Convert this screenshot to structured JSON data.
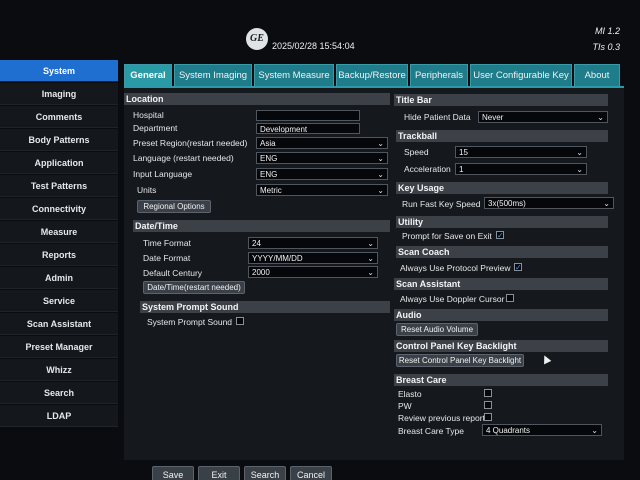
{
  "header": {
    "datetime": "2025/02/28 15:54:04",
    "mi": "MI 1.2",
    "tis": "TIs 0.3",
    "logo": "GE"
  },
  "sidebar": {
    "items": [
      {
        "label": "System",
        "active": true
      },
      {
        "label": "Imaging"
      },
      {
        "label": "Comments"
      },
      {
        "label": "Body Patterns"
      },
      {
        "label": "Application"
      },
      {
        "label": "Test Patterns"
      },
      {
        "label": "Connectivity"
      },
      {
        "label": "Measure"
      },
      {
        "label": "Reports"
      },
      {
        "label": "Admin"
      },
      {
        "label": "Service"
      },
      {
        "label": "Scan Assistant"
      },
      {
        "label": "Preset Manager"
      },
      {
        "label": "Whizz"
      },
      {
        "label": "Search"
      },
      {
        "label": "LDAP"
      }
    ]
  },
  "tabs": [
    {
      "label": "General",
      "active": true
    },
    {
      "label": "System Imaging"
    },
    {
      "label": "System Measure"
    },
    {
      "label": "Backup/Restore"
    },
    {
      "label": "Peripherals"
    },
    {
      "label": "User Configurable Key"
    },
    {
      "label": "About"
    }
  ],
  "location": {
    "title": "Location",
    "hospital_label": "Hospital",
    "hospital_value": "",
    "department_label": "Department",
    "department_value": "Development",
    "preset_region_label": "Preset Region(restart needed)",
    "preset_region_value": "Asia",
    "language_label": "Language (restart needed)",
    "language_value": "ENG",
    "input_language_label": "Input Language",
    "input_language_value": "ENG",
    "units_label": "Units",
    "units_value": "Metric",
    "regional_options_button": "Regional Options"
  },
  "datetime_section": {
    "title": "Date/Time",
    "time_format_label": "Time Format",
    "time_format_value": "24",
    "date_format_label": "Date Format",
    "date_format_value": "YYYY/MM/DD",
    "default_century_label": "Default Century",
    "default_century_value": "2000",
    "restart_button": "Date/Time(restart needed)"
  },
  "prompt_sound": {
    "title": "System Prompt Sound",
    "label": "System Prompt Sound",
    "checked": false
  },
  "title_bar": {
    "title": "Title Bar",
    "hide_label": "Hide Patient Data",
    "hide_value": "Never"
  },
  "trackball": {
    "title": "Trackball",
    "speed_label": "Speed",
    "speed_value": "15",
    "accel_label": "Acceleration",
    "accel_value": "1"
  },
  "key_usage": {
    "title": "Key Usage",
    "label": "Run Fast Key Speed",
    "value": "3x(500ms)"
  },
  "utility": {
    "title": "Utility",
    "label": "Prompt for Save on Exit",
    "checked": true
  },
  "scan_coach": {
    "title": "Scan Coach",
    "label": "Always Use Protocol Preview",
    "checked": true
  },
  "scan_assistant": {
    "title": "Scan Assistant",
    "label": "Always Use Doppler Cursor",
    "checked": false
  },
  "audio": {
    "title": "Audio",
    "button": "Reset Audio Volume"
  },
  "backlight": {
    "title": "Control Panel Key Backlight",
    "button": "Reset Control Panel Key Backlight"
  },
  "breast_care": {
    "title": "Breast Care",
    "elasto_label": "Elasto",
    "pw_label": "PW",
    "review_label": "Review previous report",
    "type_label": "Breast Care Type",
    "type_value": "4 Quadrants"
  },
  "footer": {
    "save": "Save",
    "exit": "Exit",
    "search": "Search",
    "cancel": "Cancel"
  },
  "glyphs": {
    "chevron": "⌄",
    "check": "✓"
  },
  "colors": {
    "accent": "#1f6fd1",
    "tab": "#1f7c8a",
    "section": "#3c4148"
  }
}
